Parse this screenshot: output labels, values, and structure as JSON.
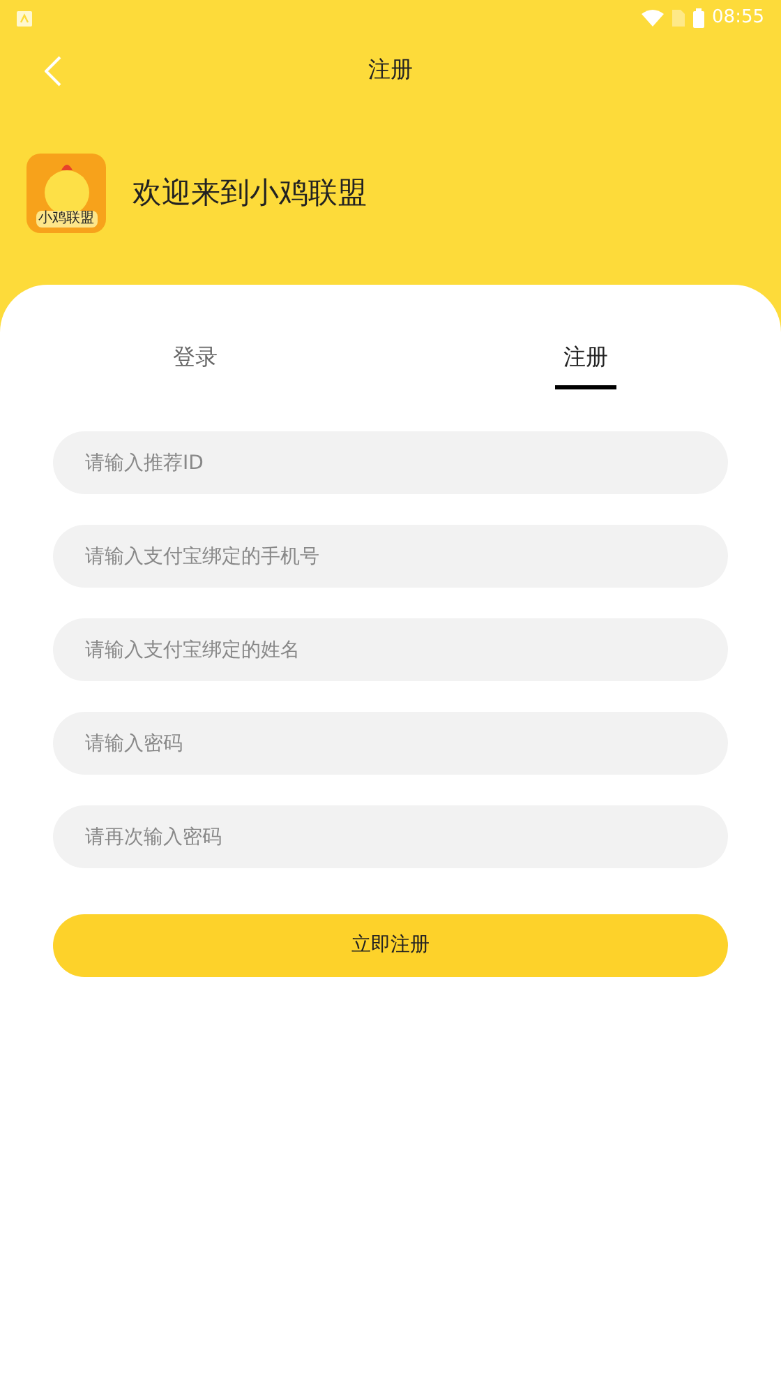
{
  "status_bar": {
    "time": "08:55"
  },
  "header": {
    "title": "注册",
    "welcome": "欢迎来到小鸡联盟",
    "app_icon_label": "小鸡联盟"
  },
  "tabs": [
    {
      "label": "登录",
      "selected": false
    },
    {
      "label": "注册",
      "selected": true
    }
  ],
  "fields": [
    {
      "placeholder": "请输入推荐ID"
    },
    {
      "placeholder": "请输入支付宝绑定的手机号"
    },
    {
      "placeholder": "请输入支付宝绑定的姓名"
    },
    {
      "placeholder": "请输入密码"
    },
    {
      "placeholder": "请再次输入密码"
    }
  ],
  "submit_button": "立即注册"
}
